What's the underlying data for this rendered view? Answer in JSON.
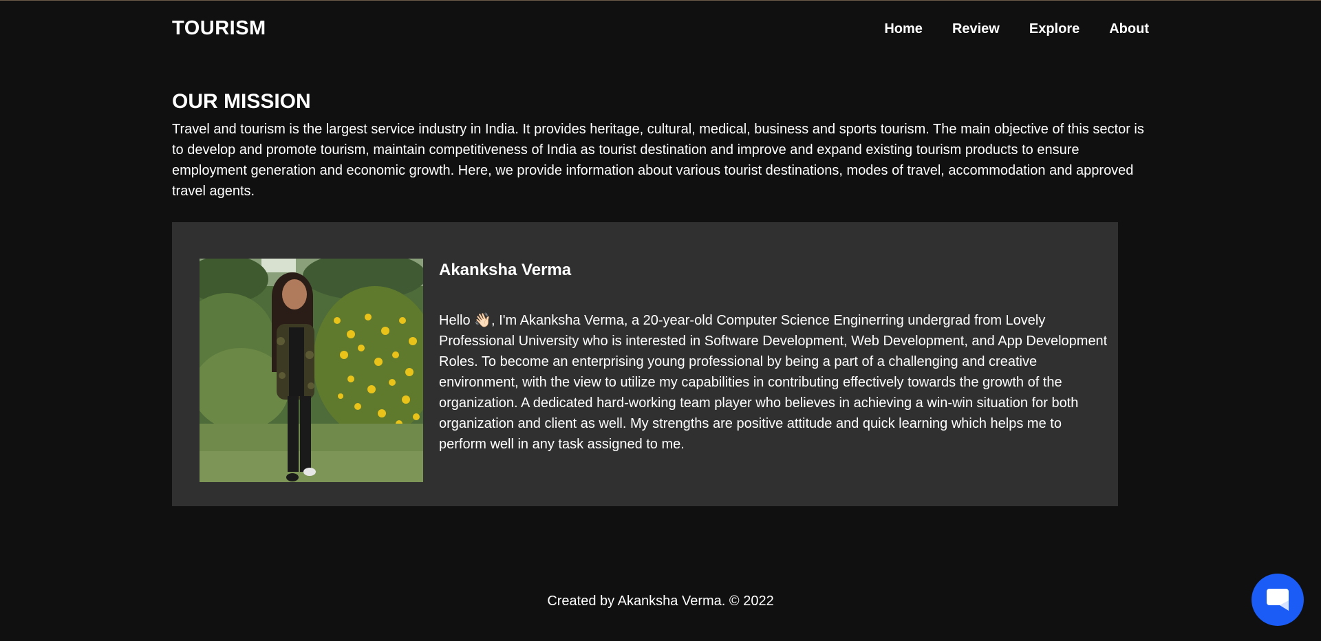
{
  "header": {
    "logo": "TOURISM",
    "nav": [
      "Home",
      "Review",
      "Explore",
      "About"
    ]
  },
  "mission": {
    "title": "OUR MISSION",
    "text": "Travel and tourism is the largest service industry in India. It provides heritage, cultural, medical, business and sports tourism. The main objective of this sector is to develop and promote tourism, maintain competitiveness of India as tourist destination and improve and expand existing tourism products to ensure employment generation and economic growth. Here, we provide information about various tourist destinations, modes of travel, accommodation and approved travel agents."
  },
  "profile": {
    "name": "Akanksha Verma",
    "bio": "Hello 👋🏻, I'm Akanksha Verma, a 20-year-old Computer Science Enginerring undergrad from Lovely Professional University who is interested in Software Development, Web Development, and App Development Roles. To become an enterprising young professional by being a part of a challenging and creative environment, with the view to utilize my capabilities in contributing effectively towards the growth of the organization. A dedicated hard-working team player who believes in achieving a win-win situation for both organization and client as well. My strengths are positive attitude and quick learning which helps me to perform well in any task assigned to me."
  },
  "footer": {
    "text": "Created by Akanksha Verma. © 2022"
  },
  "chat": {
    "icon": "chat-bubble-icon",
    "color": "#1a5cf5"
  },
  "colors": {
    "background": "#101010",
    "card": "#303030",
    "text": "#ffffff"
  }
}
